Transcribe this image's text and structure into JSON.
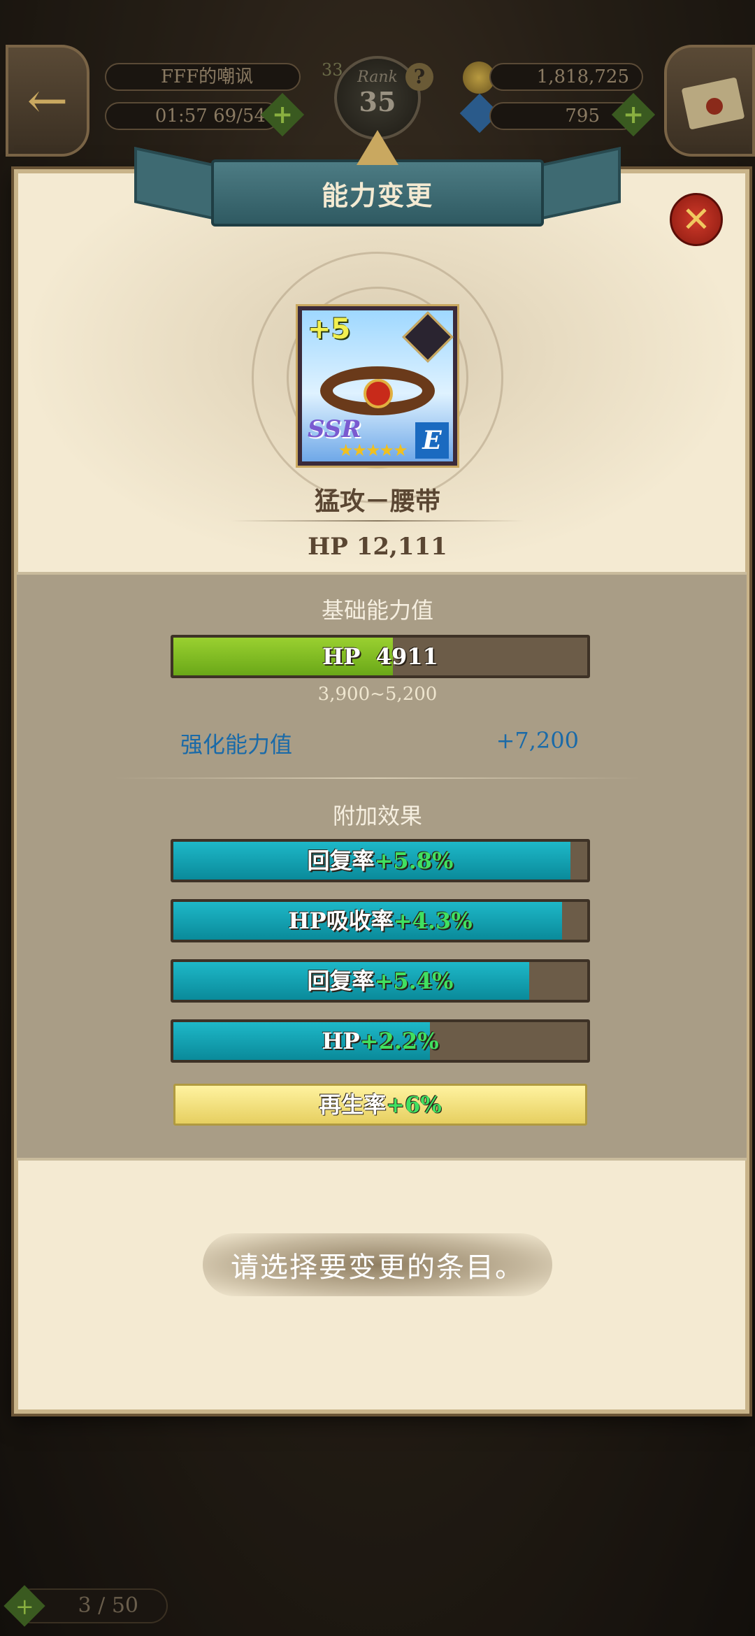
{
  "hud": {
    "player_name": "FFF的嘲讽",
    "stamina_time": "01:57",
    "stamina_value": "69/54",
    "rank_label": "Rank",
    "rank_value": "35",
    "gold": "1,818,725",
    "gems": "795",
    "help_symbol": "?",
    "plus_symbol": "+",
    "back_symbol": "←",
    "level_badge": "33"
  },
  "dialog": {
    "title": "能力变更",
    "close_symbol": "✕"
  },
  "item": {
    "enhance_level": "+5",
    "rarity": "SSR",
    "stars": "★★★★★",
    "element": "E",
    "name": "猛攻－腰带",
    "total_stat": "HP 12,111"
  },
  "base_stats": {
    "heading": "基础能力值",
    "bar_label": "HP",
    "bar_value": "4911",
    "fill_fraction": 0.53,
    "range": "3,900~5,200",
    "enhance_label": "强化能力值",
    "enhance_value": "+7,200"
  },
  "extra_effects": {
    "heading": "附加效果",
    "items": [
      {
        "label": "回复率",
        "value": "+5.8%",
        "fill_fraction": 0.96,
        "color": "#1eb8c8"
      },
      {
        "label": "HP吸收率",
        "value": "+4.3%",
        "fill_fraction": 0.94,
        "color": "#1eb8c8"
      },
      {
        "label": "回复率",
        "value": "+5.4%",
        "fill_fraction": 0.86,
        "color": "#1eb8c8"
      },
      {
        "label": "HP",
        "value": "+2.2%",
        "fill_fraction": 0.62,
        "color": "#1eb8c8"
      }
    ],
    "locked_item": {
      "label": "再生率",
      "value": "+6%"
    }
  },
  "prompt": "请选择要变更的条目。",
  "bottom": {
    "counter": "3 / 50"
  },
  "colors": {
    "accent_teal": "#3e6a72",
    "parchment": "#f4ead2",
    "green_fill": "#8cc428",
    "bonus_text": "#40e060",
    "enhance_blue": "#1a6aa8"
  }
}
